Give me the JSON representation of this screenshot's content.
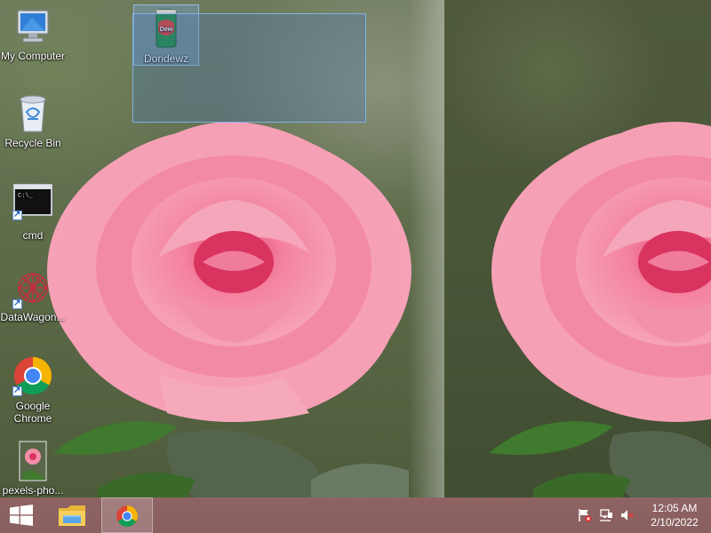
{
  "desktop": {
    "icons": [
      {
        "name": "my-computer",
        "label": "My Computer"
      },
      {
        "name": "recycle-bin",
        "label": "Recycle Bin"
      },
      {
        "name": "cmd",
        "label": "cmd"
      },
      {
        "name": "datawagon",
        "label": "DataWagon..."
      },
      {
        "name": "google-chrome",
        "label": "Google Chrome"
      },
      {
        "name": "pexels-photo",
        "label": "pexels-pho..."
      },
      {
        "name": "doridewz",
        "label": "Doridewz"
      }
    ],
    "icon_glyphs": {
      "my-computer": "monitor-icon",
      "recycle-bin": "recycle-bin-icon",
      "cmd": "command-prompt-icon",
      "datawagon": "datawagon-icon",
      "google-chrome": "chrome-icon",
      "pexels-photo": "image-thumbnail-icon",
      "doridewz": "soda-can-icon"
    },
    "can_text": "Dew"
  },
  "taskbar": {
    "start_icon": "windows-logo-icon",
    "pinned": [
      {
        "name": "file-explorer",
        "icon": "folder-icon"
      },
      {
        "name": "google-chrome",
        "icon": "chrome-icon",
        "active": true
      }
    ],
    "tray": {
      "icons": [
        "action-center-flag-icon",
        "network-icon",
        "volume-muted-icon"
      ],
      "time": "12:05 AM",
      "date": "2/10/2022"
    }
  },
  "colors": {
    "taskbar": "#8a5f5f",
    "selection": "#4678be",
    "rose": "#f07c9c"
  }
}
